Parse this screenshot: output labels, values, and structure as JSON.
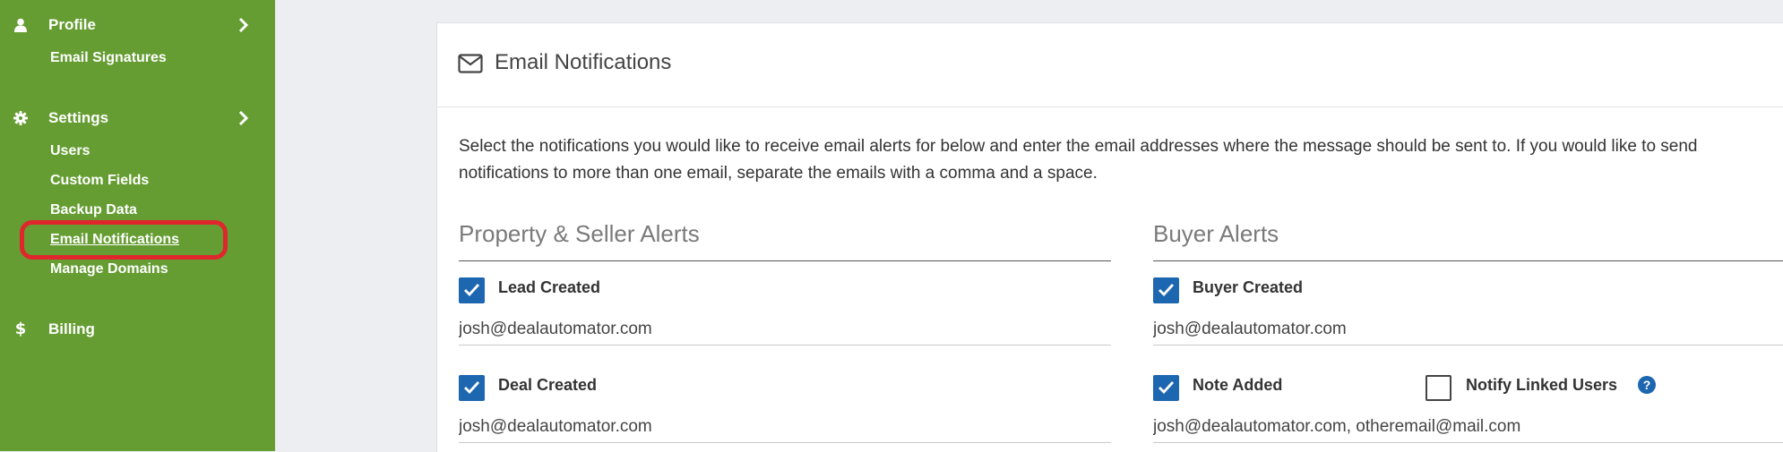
{
  "sidebar": {
    "profile": {
      "label": "Profile",
      "icon": "user-icon"
    },
    "profile_items": [
      {
        "label": "Email Signatures"
      }
    ],
    "settings": {
      "label": "Settings",
      "icon": "gear-icon"
    },
    "settings_items": [
      {
        "label": "Users"
      },
      {
        "label": "Custom Fields"
      },
      {
        "label": "Backup Data"
      },
      {
        "label": "Email Notifications",
        "active": true
      },
      {
        "label": "Manage Domains"
      }
    ],
    "billing": {
      "label": "Billing",
      "icon": "dollar-icon"
    },
    "colors": {
      "background": "#659d32",
      "highlight": "#e0262d"
    }
  },
  "card": {
    "title": "Email Notifications",
    "icon": "envelope-icon",
    "intro": "Select the notifications you would like to receive email alerts for below and enter the email addresses where the message should be sent to. If you would like to send notifications to more than one email, separate the emails with a comma and a space.",
    "property_seller": {
      "title": "Property & Seller Alerts",
      "lead_created": {
        "label": "Lead Created",
        "checked": true,
        "email": "josh@dealautomator.com"
      },
      "deal_created": {
        "label": "Deal Created",
        "checked": true,
        "email": "josh@dealautomator.com"
      }
    },
    "buyer": {
      "title": "Buyer Alerts",
      "buyer_created": {
        "label": "Buyer Created",
        "checked": true,
        "email": "josh@dealautomator.com"
      },
      "note_added": {
        "label": "Note Added",
        "checked": true,
        "email": "josh@dealautomator.com, otheremail@mail.com"
      },
      "notify_linked_users": {
        "label": "Notify Linked Users",
        "checked": false,
        "help_icon": "question-circle-icon",
        "help_text": "?"
      }
    },
    "colors": {
      "checkbox": "#1d66b0",
      "section_title": "#7a7a7a"
    }
  }
}
